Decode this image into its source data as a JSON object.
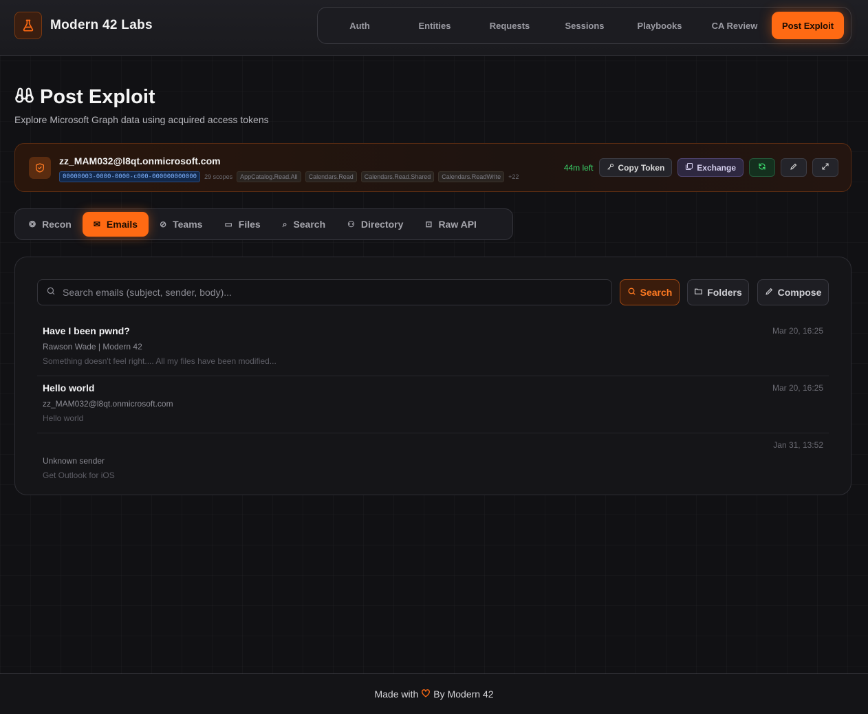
{
  "app": {
    "brand_name": "Modern 42 Labs",
    "brand_icon": "flask-icon",
    "accent_color": "#ff6a13"
  },
  "nav": {
    "items": [
      {
        "label": "Auth",
        "active": false
      },
      {
        "label": "Entities",
        "active": false
      },
      {
        "label": "Requests",
        "active": false
      },
      {
        "label": "Sessions",
        "active": false
      },
      {
        "label": "Playbooks",
        "active": false
      },
      {
        "label": "CA Review",
        "active": false
      },
      {
        "label": "Post Exploit",
        "active": true
      }
    ]
  },
  "page": {
    "title": "Post Exploit",
    "title_icon": "binoculars-icon",
    "subtitle": "Explore Microsoft Graph data using acquired access tokens"
  },
  "token": {
    "email": "zz_MAM032@l8qt.onmicrosoft.com",
    "tenant_id": "00000003-0000-0000-c000-000000000000",
    "scope_count": "29 scopes",
    "scopes": [
      "AppCatalog.Read.All",
      "Calendars.Read",
      "Calendars.Read.Shared",
      "Calendars.ReadWrite"
    ],
    "scopes_more": "+22",
    "time_left": "44m left",
    "copy_label": "Copy Token",
    "exchange_label": "Exchange"
  },
  "tabs": [
    {
      "label": "Recon",
      "icon": "robot-icon",
      "glyph": "❂",
      "active": false
    },
    {
      "label": "Emails",
      "icon": "mail-icon",
      "glyph": "✉",
      "active": true
    },
    {
      "label": "Teams",
      "icon": "chat-icon",
      "glyph": "⊘",
      "active": false
    },
    {
      "label": "Files",
      "icon": "folder-icon",
      "glyph": "▭",
      "active": false
    },
    {
      "label": "Search",
      "icon": "search-icon",
      "glyph": "⌕",
      "active": false
    },
    {
      "label": "Directory",
      "icon": "users-icon",
      "glyph": "⚇",
      "active": false
    },
    {
      "label": "Raw API",
      "icon": "terminal-icon",
      "glyph": "⊡",
      "active": false
    }
  ],
  "emails_panel": {
    "search_placeholder": "Search emails (subject, sender, body)...",
    "search_value": "",
    "search_button": "Search",
    "folders_button": "Folders",
    "compose_button": "Compose",
    "emails": [
      {
        "subject": "Have I been pwnd?",
        "sender": "Rawson Wade | Modern 42",
        "preview": "Something doesn't feel right.... All my files have been modified...",
        "date": "Mar 20, 16:25"
      },
      {
        "subject": "Hello world",
        "sender": "zz_MAM032@l8qt.onmicrosoft.com",
        "preview": "Hello world",
        "date": "Mar 20, 16:25"
      },
      {
        "subject": "",
        "sender": "Unknown sender",
        "preview": "Get Outlook for iOS",
        "date": "Jan 31, 13:52"
      }
    ]
  },
  "footer": {
    "made_with": "Made with",
    "by": "By",
    "author": "Modern 42",
    "heart_icon": "heart-icon"
  }
}
